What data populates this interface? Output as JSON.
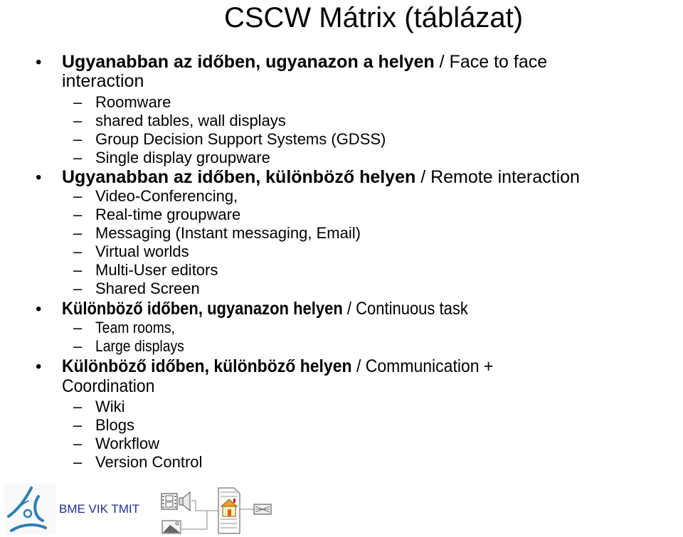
{
  "slide": {
    "title": "CSCW Mátrix (táblázat)",
    "sections": [
      {
        "bold": "Ugyanabban az időben, ugyanazon a helyen",
        "normal": " / Face to face",
        "continuation": "interaction",
        "items": [
          "Roomware",
          "shared tables, wall displays",
          "Group Decision Support Systems (GDSS)",
          "Single display groupware"
        ]
      },
      {
        "bold": "Ugyanabban az időben, különböző helyen",
        "normal": " / Remote interaction",
        "items": [
          "Video-Conferencing,",
          "Real-time groupware",
          "Messaging (Instant messaging, Email)",
          "Virtual worlds",
          "Multi-User editors",
          "Shared Screen"
        ]
      },
      {
        "bold": "Különböző időben, ugyanazon helyen",
        "normal": " / Continuous task",
        "items": [
          "Team rooms,",
          "Large displays"
        ]
      },
      {
        "bold": "Különböző időben, különböző helyen",
        "normal": " / Communication +",
        "continuation": "Coordination",
        "items": [
          "Wiki",
          "Blogs",
          "Workflow",
          "Version Control"
        ]
      }
    ],
    "bullet_glyph": "•",
    "dash_glyph": "–"
  },
  "footer": {
    "org_text": "BME VIK TMIT",
    "logo_icon": "bme-logo-icon",
    "media_icon": "multimedia-document-icon",
    "colors": {
      "org_text": "#1f2f8f",
      "logo": "#2f7fb0"
    }
  }
}
